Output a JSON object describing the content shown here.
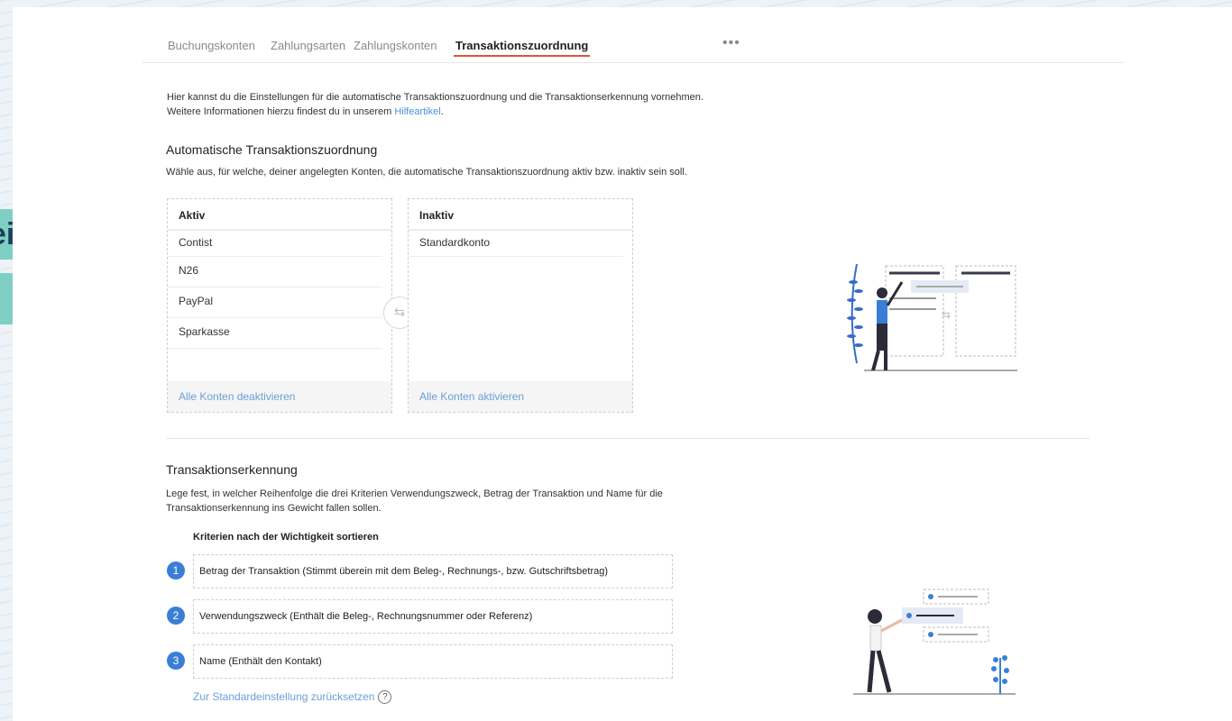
{
  "background": {
    "teal_text": "eit"
  },
  "tabs": [
    {
      "label": "Buchungskonten",
      "active": false
    },
    {
      "label": "Zahlungsarten",
      "active": false
    },
    {
      "label": "Zahlungskonten",
      "active": false
    },
    {
      "label": "Transaktionszuordnung",
      "active": true
    }
  ],
  "tabs_more": "•••",
  "intro": {
    "line1": "Hier kannst du die Einstellungen für die automatische Transaktionszuordnung und die Transaktionserkennung vornehmen.",
    "line2_prefix": "Weitere Informationen hierzu findest du in unserem ",
    "link": "Hilfeartikel",
    "line2_suffix": "."
  },
  "auto": {
    "title": "Automatische Transaktionszuordnung",
    "subtitle": "Wähle aus, für welche, deiner angelegten Konten, die automatische Transaktionszuordnung aktiv bzw. inaktiv sein soll.",
    "active": {
      "header": "Aktiv",
      "items": [
        "Contist",
        "N26",
        "PayPal",
        "Sparkasse"
      ],
      "footer": "Alle Konten deaktivieren"
    },
    "inactive": {
      "header": "Inaktiv",
      "items": [
        "Standardkonto"
      ],
      "footer": "Alle Konten aktivieren"
    },
    "swap_icon": "⇆"
  },
  "recognition": {
    "title": "Transaktionserkennung",
    "subtitle_line1": "Lege fest, in welcher Reihenfolge die drei Kriterien Verwendungszweck, Betrag der Transaktion und Name für die",
    "subtitle_line2": "Transaktionserkennung ins Gewicht fallen sollen.",
    "criteria_label": "Kriterien nach der Wichtigkeit sortieren",
    "criteria": [
      {
        "num": "1",
        "text": "Betrag der Transaktion (Stimmt überein mit dem Beleg-, Rechnungs-, bzw. Gutschriftsbetrag)"
      },
      {
        "num": "2",
        "text": "Verwendungszweck (Enthält die Beleg-, Rechnungsnummer oder Referenz)"
      },
      {
        "num": "3",
        "text": "Name (Enthält den Kontakt)"
      }
    ],
    "reset_link": "Zur Standardeinstellung zurücksetzen",
    "help_icon": "?"
  },
  "colors": {
    "accent_tab": "#e2513b",
    "link": "#4a90d9",
    "number_badge": "#3a7fd5",
    "teal": "#7fcfc4"
  }
}
